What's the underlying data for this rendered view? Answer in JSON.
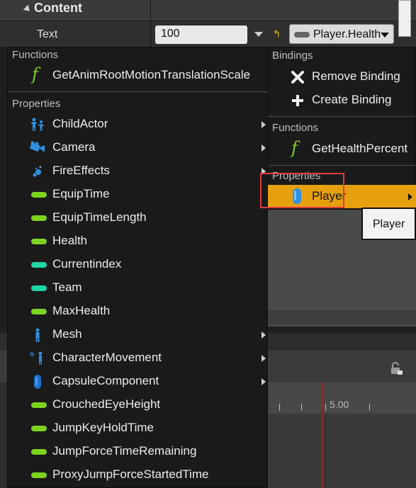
{
  "details": {
    "section_title": "Content",
    "text_label": "Text",
    "text_value": "100",
    "binding_value": "Player.Health"
  },
  "left_menu": {
    "functions_header": "Functions",
    "functions": [
      {
        "label": "GetAnimRootMotionTranslationScale",
        "icon": "function-icon"
      }
    ],
    "properties_header": "Properties",
    "properties": [
      {
        "label": "ChildActor",
        "icon": "child-actor-icon",
        "submenu": true
      },
      {
        "label": "Camera",
        "icon": "camera-icon",
        "submenu": true
      },
      {
        "label": "FireEffects",
        "icon": "fire-effects-icon",
        "submenu": true
      },
      {
        "label": "EquipTime",
        "icon": "float-variable-icon",
        "submenu": false
      },
      {
        "label": "EquipTimeLength",
        "icon": "float-variable-icon",
        "submenu": false
      },
      {
        "label": "Health",
        "icon": "float-variable-icon",
        "submenu": false
      },
      {
        "label": "Currentindex",
        "icon": "int-variable-icon",
        "submenu": false
      },
      {
        "label": "Team",
        "icon": "int-variable-icon",
        "submenu": false
      },
      {
        "label": "MaxHealth",
        "icon": "float-variable-icon",
        "submenu": false
      },
      {
        "label": "Mesh",
        "icon": "mesh-icon",
        "submenu": true
      },
      {
        "label": "CharacterMovement",
        "icon": "character-movement-icon",
        "submenu": true
      },
      {
        "label": "CapsuleComponent",
        "icon": "capsule-icon",
        "submenu": true
      },
      {
        "label": "CrouchedEyeHeight",
        "icon": "float-variable-icon",
        "submenu": false
      },
      {
        "label": "JumpKeyHoldTime",
        "icon": "float-variable-icon",
        "submenu": false
      },
      {
        "label": "JumpForceTimeRemaining",
        "icon": "float-variable-icon",
        "submenu": false
      },
      {
        "label": "ProxyJumpForceStartedTime",
        "icon": "float-variable-icon",
        "submenu": false
      }
    ]
  },
  "right_menu": {
    "bindings_header": "Bindings",
    "remove_binding": "Remove Binding",
    "create_binding": "Create Binding",
    "functions_header": "Functions",
    "get_health_percent": "GetHealthPercent",
    "properties_header": "Properties",
    "player": "Player"
  },
  "tooltip": "Player",
  "timeline": {
    "ruler_label": "5.00"
  },
  "colors": {
    "selected_highlight": "#e6a00e",
    "float_variable": "#7ed321",
    "int_variable": "#1fd6a8",
    "object_blue": "#2e8fe0",
    "annotation_red": "#e23b3b"
  }
}
